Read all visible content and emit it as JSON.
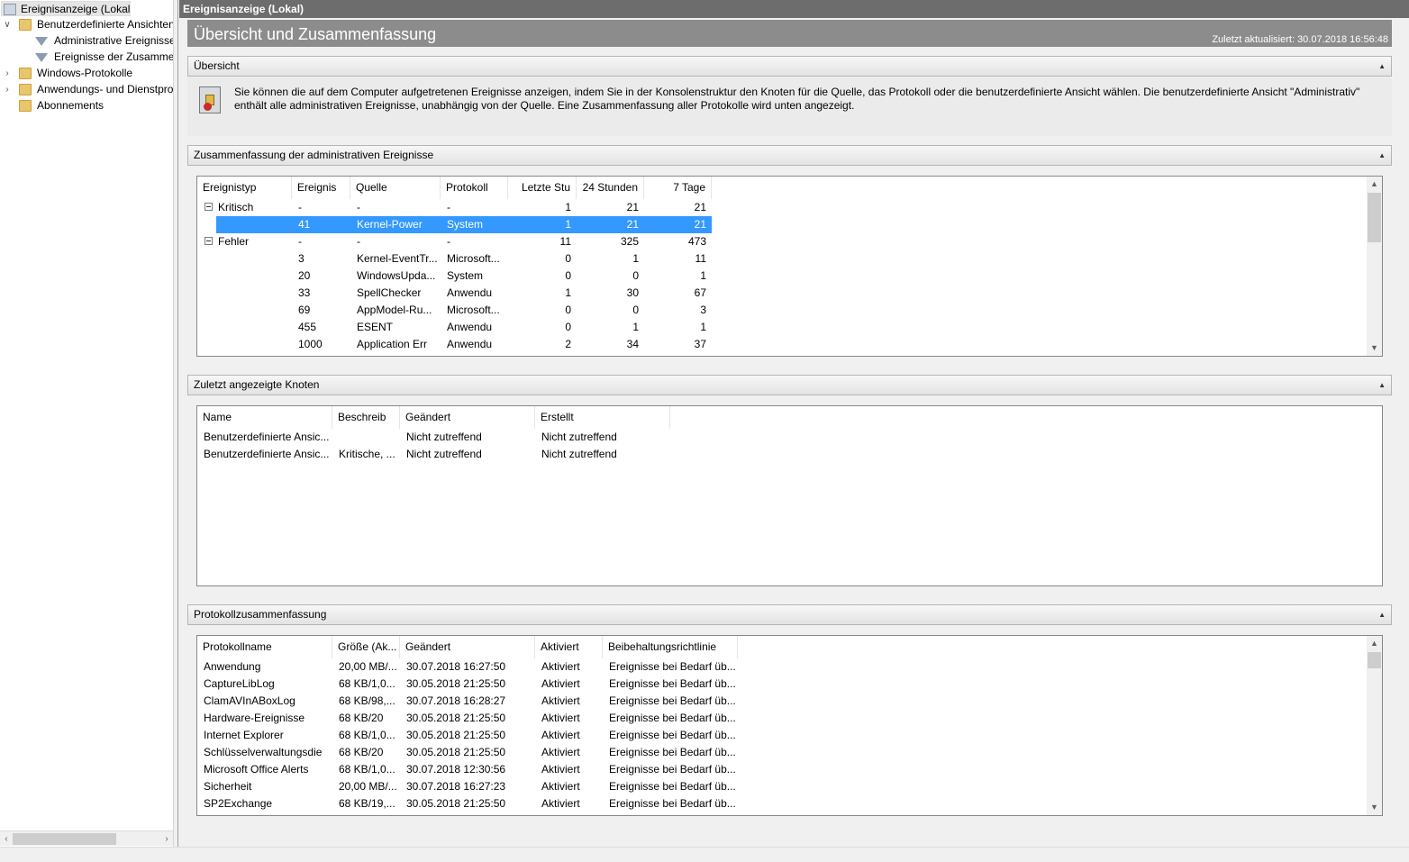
{
  "tree": {
    "root": "Ereignisanzeige (Lokal)",
    "items": [
      {
        "label": "Benutzerdefinierte Ansichten"
      },
      {
        "label": "Administrative Ereignisse"
      },
      {
        "label": "Ereignisse der Zusammenfassung"
      },
      {
        "label": "Windows-Protokolle"
      },
      {
        "label": "Anwendungs- und Dienstprotokolle"
      },
      {
        "label": "Abonnements"
      }
    ]
  },
  "window": {
    "title": "Ereignisanzeige (Lokal)",
    "header_title": "Übersicht und Zusammenfassung",
    "last_updated": "Zuletzt aktualisiert: 30.07.2018 16:56:48"
  },
  "overview": {
    "title": "Übersicht",
    "text": "Sie können die auf dem Computer aufgetretenen Ereignisse anzeigen, indem Sie in der Konsolenstruktur den Knoten für die Quelle, das Protokoll oder die benutzerdefinierte Ansicht wählen. Die benutzerdefinierte Ansicht \"Administrativ\" enthält alle administrativen Ereignisse, unabhängig von der Quelle. Eine Zusammenfassung aller Protokolle wird unten angezeigt."
  },
  "admin_summary": {
    "title": "Zusammenfassung der administrativen Ereignisse",
    "columns": [
      "Ereignistyp",
      "Ereignis",
      "Quelle",
      "Protokoll",
      "Letzte Stu",
      "24 Stunden",
      "7 Tage"
    ],
    "rows": [
      {
        "type": "Kritisch",
        "event": "-",
        "source": "-",
        "log": "-",
        "hour": "1",
        "day": "21",
        "week": "21"
      },
      {
        "type": "",
        "event": "41",
        "source": "Kernel-Power",
        "log": "System",
        "hour": "1",
        "day": "21",
        "week": "21"
      },
      {
        "type": "Fehler",
        "event": "-",
        "source": "-",
        "log": "-",
        "hour": "11",
        "day": "325",
        "week": "473"
      },
      {
        "type": "",
        "event": "3",
        "source": "Kernel-EventTr...",
        "log": "Microsoft...",
        "hour": "0",
        "day": "1",
        "week": "11"
      },
      {
        "type": "",
        "event": "20",
        "source": "WindowsUpda...",
        "log": "System",
        "hour": "0",
        "day": "0",
        "week": "1"
      },
      {
        "type": "",
        "event": "33",
        "source": "SpellChecker",
        "log": "Anwendu",
        "hour": "1",
        "day": "30",
        "week": "67"
      },
      {
        "type": "",
        "event": "69",
        "source": "AppModel-Ru...",
        "log": "Microsoft...",
        "hour": "0",
        "day": "0",
        "week": "3"
      },
      {
        "type": "",
        "event": "455",
        "source": "ESENT",
        "log": "Anwendu",
        "hour": "0",
        "day": "1",
        "week": "1"
      },
      {
        "type": "",
        "event": "1000",
        "source": "Application Err",
        "log": "Anwendu",
        "hour": "2",
        "day": "34",
        "week": "37"
      }
    ]
  },
  "recent_nodes": {
    "title": "Zuletzt angezeigte Knoten",
    "columns": [
      "Name",
      "Beschreib",
      "Geändert",
      "Erstellt"
    ],
    "rows": [
      {
        "name": "Benutzerdefinierte Ansic...",
        "desc": "",
        "changed": "Nicht zutreffend",
        "created": "Nicht zutreffend"
      },
      {
        "name": "Benutzerdefinierte Ansic...",
        "desc": "Kritische, ...",
        "changed": "Nicht zutreffend",
        "created": "Nicht zutreffend"
      }
    ]
  },
  "log_summary": {
    "title": "Protokollzusammenfassung",
    "columns": [
      "Protokollname",
      "Größe (Ak...",
      "Geändert",
      "Aktiviert",
      "Beibehaltungsrichtlinie"
    ],
    "rows": [
      {
        "name": "Anwendung",
        "size": "20,00 MB/...",
        "changed": "30.07.2018 16:27:50",
        "enabled": "Aktiviert",
        "policy": "Ereignisse bei Bedarf üb..."
      },
      {
        "name": "CaptureLibLog",
        "size": "68 KB/1,0...",
        "changed": "30.05.2018 21:25:50",
        "enabled": "Aktiviert",
        "policy": "Ereignisse bei Bedarf üb..."
      },
      {
        "name": "ClamAVInABoxLog",
        "size": "68 KB/98,...",
        "changed": "30.07.2018 16:28:27",
        "enabled": "Aktiviert",
        "policy": "Ereignisse bei Bedarf üb..."
      },
      {
        "name": "Hardware-Ereignisse",
        "size": "68 KB/20",
        "changed": "30.05.2018 21:25:50",
        "enabled": "Aktiviert",
        "policy": "Ereignisse bei Bedarf üb..."
      },
      {
        "name": "Internet Explorer",
        "size": "68 KB/1,0...",
        "changed": "30.05.2018 21:25:50",
        "enabled": "Aktiviert",
        "policy": "Ereignisse bei Bedarf üb..."
      },
      {
        "name": "Schlüsselverwaltungsdie",
        "size": "68 KB/20",
        "changed": "30.05.2018 21:25:50",
        "enabled": "Aktiviert",
        "policy": "Ereignisse bei Bedarf üb..."
      },
      {
        "name": "Microsoft Office Alerts",
        "size": "68 KB/1,0...",
        "changed": "30.07.2018 12:30:56",
        "enabled": "Aktiviert",
        "policy": "Ereignisse bei Bedarf üb..."
      },
      {
        "name": "Sicherheit",
        "size": "20,00 MB/...",
        "changed": "30.07.2018 16:27:23",
        "enabled": "Aktiviert",
        "policy": "Ereignisse bei Bedarf üb..."
      },
      {
        "name": "SP2Exchange",
        "size": "68 KB/19,...",
        "changed": "30.05.2018 21:25:50",
        "enabled": "Aktiviert",
        "policy": "Ereignisse bei Bedarf üb..."
      }
    ]
  },
  "icons": {
    "expand": "chevron-right-icon",
    "collapse": "chevron-down-icon",
    "section_collapse": "caret-up-icon"
  },
  "colors": {
    "selection": "#3399ff",
    "titlebar": "#6d6d6d",
    "header": "#8c8c8c"
  }
}
